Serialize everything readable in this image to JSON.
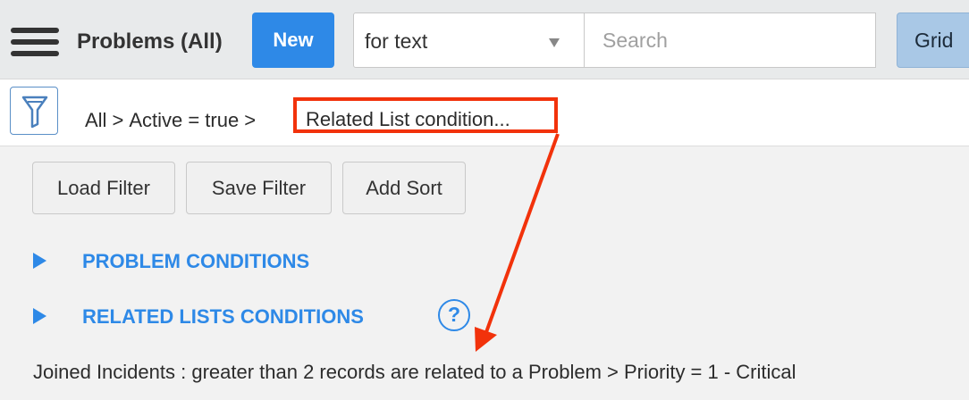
{
  "header": {
    "title": "Problems (All)",
    "new_label": "New",
    "search_field": {
      "selected": "for text"
    },
    "search": {
      "placeholder": "Search"
    },
    "grid_label": "Grid"
  },
  "breadcrumb": {
    "items": [
      "All",
      "Active = true",
      "Related List condition..."
    ],
    "separator": ">"
  },
  "filter_buttons": {
    "load": "Load Filter",
    "save": "Save Filter",
    "sort": "Add Sort"
  },
  "sections": {
    "problem_conditions": "PROBLEM CONDITIONS",
    "related_lists_conditions": "RELATED LISTS CONDITIONS",
    "help_glyph": "?"
  },
  "summary": "Joined Incidents : greater than 2 records are related to a Problem  > Priority = 1 - Critical",
  "icons": [
    "menu-icon",
    "filter-funnel-icon",
    "caret-down-icon",
    "triangle-right-icon",
    "help-icon"
  ],
  "colors": {
    "accent": "#2e89e7",
    "annotation": "#f2320b",
    "grid_button": "#a9c8e6"
  }
}
